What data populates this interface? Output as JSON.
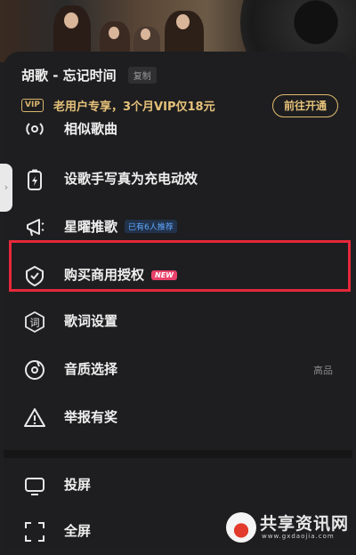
{
  "song": {
    "title": "胡歌 - 忘记时间",
    "copy_label": "复制"
  },
  "vip_banner": {
    "tag": "VIP",
    "text": "老用户专享，3个月VIP仅18元",
    "button": "前往开通"
  },
  "menu": {
    "similar": {
      "label": "相似歌曲",
      "icon": "radio-waves-icon"
    },
    "handwrite": {
      "label": "设歌手写真为充电动效",
      "icon": "battery-charge-icon"
    },
    "recommend": {
      "label": "星曜推歌",
      "icon": "megaphone-icon",
      "badge": "已有6人推荐"
    },
    "license": {
      "label": "购买商用授权",
      "icon": "shield-check-icon",
      "badge": "NEW"
    },
    "lyrics": {
      "label": "歌词设置",
      "icon": "lyrics-icon",
      "icon_glyph": "词"
    },
    "quality": {
      "label": "音质选择",
      "icon": "disc-icon",
      "value": "高品"
    },
    "report": {
      "label": "举报有奖",
      "icon": "warning-icon"
    },
    "cast": {
      "label": "投屏",
      "icon": "cast-screen-icon"
    },
    "fullscreen": {
      "label": "全屏",
      "icon": "fullscreen-icon"
    }
  },
  "side_tab": {
    "glyph": "›"
  },
  "watermark": {
    "title": "共享资讯网",
    "url": "www.gxdaojia.com"
  },
  "colors": {
    "background": "#1f1f21",
    "vip_gold": "#e6c27a",
    "highlight": "#e5283a",
    "accent_blue": "#5fa8ff",
    "new_pink": "#e8416a"
  }
}
